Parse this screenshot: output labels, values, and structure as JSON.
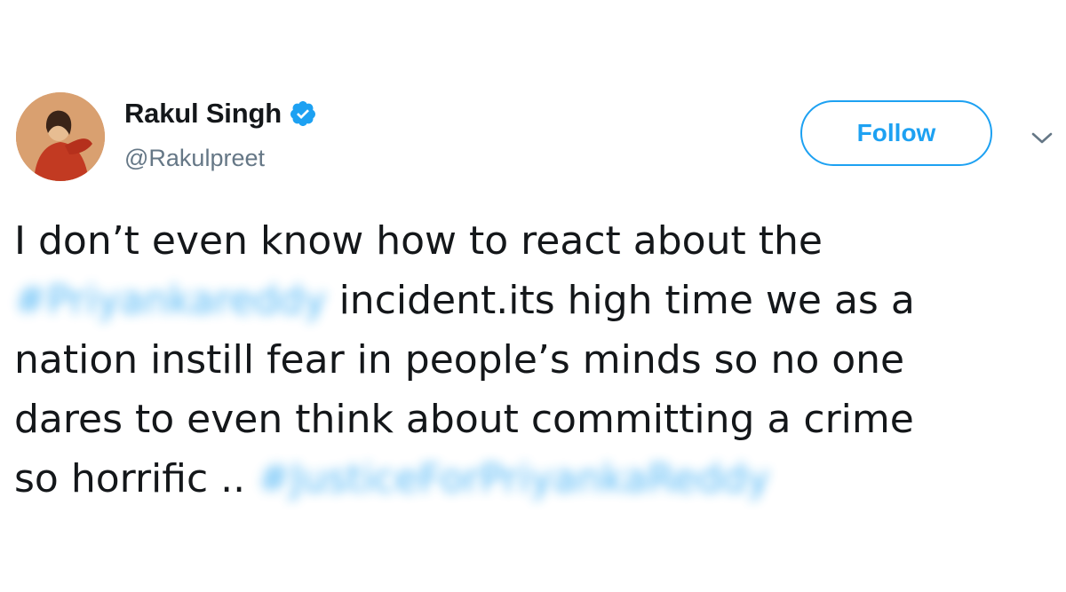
{
  "user": {
    "display_name": "Rakul Singh",
    "handle": "@Rakulpreet",
    "verified": true
  },
  "actions": {
    "follow_label": "Follow",
    "menu_icon": "chevron-down-icon"
  },
  "tweet": {
    "line1": "I don’t even know how to react about the",
    "hashtag1": "#Priyankareddy",
    "line2_rest": " incident.its high time we as a",
    "line3": "nation instill fear in people’s minds so no one",
    "line4": "dares to even think about committing a crime",
    "line5_start": "so horrific .. ",
    "hashtag2": "#JusticeForPriyankaReddy"
  },
  "colors": {
    "accent": "#1da1f2",
    "text": "#14171a",
    "secondary": "#657786"
  }
}
